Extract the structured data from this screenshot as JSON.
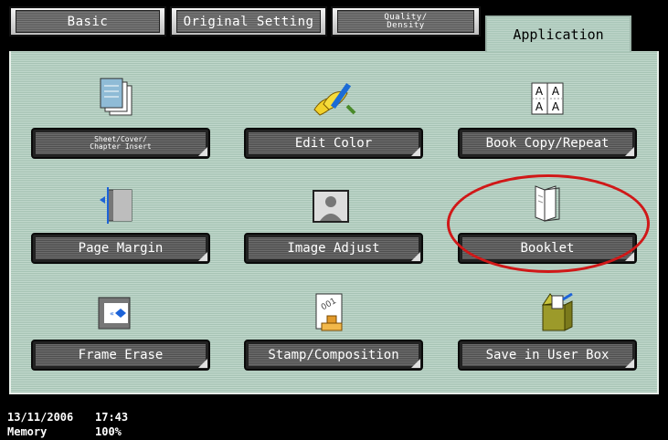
{
  "tabs": {
    "basic": "Basic",
    "original_setting": "Original Setting",
    "quality_density": "Quality/\nDensity",
    "application": "Application"
  },
  "buttons": {
    "sheet_cover": "Sheet/Cover/\nChapter Insert",
    "edit_color": "Edit Color",
    "book_copy": "Book Copy/Repeat",
    "page_margin": "Page Margin",
    "image_adjust": "Image Adjust",
    "booklet": "Booklet",
    "frame_erase": "Frame Erase",
    "stamp_composition": "Stamp/Composition",
    "save_in_user_box": "Save in User Box"
  },
  "book_copy_icon_letters": [
    "A",
    "A",
    "A",
    "A"
  ],
  "status": {
    "date": "13/11/2006",
    "time": "17:43",
    "memory_label": "Memory",
    "memory_value": "100%"
  },
  "colors": {
    "panel": "#b3ccbf",
    "highlight": "#d01818",
    "button": "#5e5e5e"
  }
}
